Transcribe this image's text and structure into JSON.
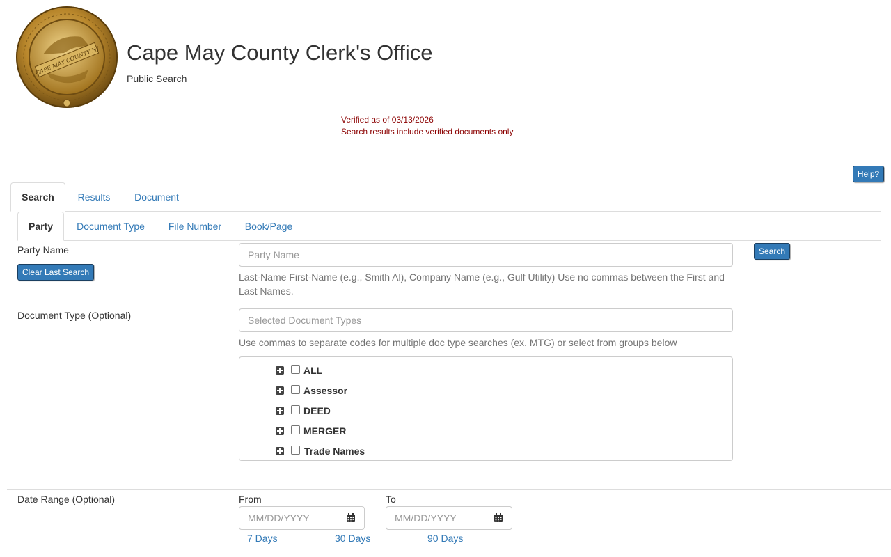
{
  "header": {
    "title": "Cape May County Clerk's Office",
    "subtitle": "Public Search",
    "seal_text": "CAPE MAY COUNTY NJ",
    "verified_line1": "Verified as of 03/13/2026",
    "verified_line2": "Search results include verified documents only"
  },
  "help_button": "Help?",
  "main_tabs": [
    {
      "label": "Search",
      "active": true
    },
    {
      "label": "Results",
      "active": false
    },
    {
      "label": "Document",
      "active": false
    }
  ],
  "sub_tabs": [
    {
      "label": "Party",
      "active": true
    },
    {
      "label": "Document Type",
      "active": false
    },
    {
      "label": "File Number",
      "active": false
    },
    {
      "label": "Book/Page",
      "active": false
    }
  ],
  "party": {
    "label": "Party Name",
    "placeholder": "Party Name",
    "value": "",
    "help": "Last-Name First-Name (e.g., Smith Al), Company Name (e.g., Gulf Utility) Use no commas between the First and Last Names.",
    "search_button": "Search",
    "clear_button": "Clear Last Search"
  },
  "doc_type": {
    "label": "Document Type (Optional)",
    "placeholder": "Selected Document Types",
    "help": "Use commas to separate codes for multiple doc type searches (ex. MTG) or select from groups below",
    "groups": [
      {
        "label": "ALL",
        "checked": false
      },
      {
        "label": "Assessor",
        "checked": false
      },
      {
        "label": "DEED",
        "checked": false
      },
      {
        "label": "MERGER",
        "checked": false
      },
      {
        "label": "Trade Names",
        "checked": false
      }
    ]
  },
  "date_range": {
    "label": "Date Range (Optional)",
    "from_label": "From",
    "to_label": "To",
    "from_placeholder": "MM/DD/YYYY",
    "to_placeholder": "MM/DD/YYYY",
    "quick_links": [
      "7 Days",
      "30 Days",
      "90 Days"
    ]
  },
  "colors": {
    "accent": "#337ab7",
    "notice": "#8b0000",
    "seal_gold": "#b8862b"
  }
}
